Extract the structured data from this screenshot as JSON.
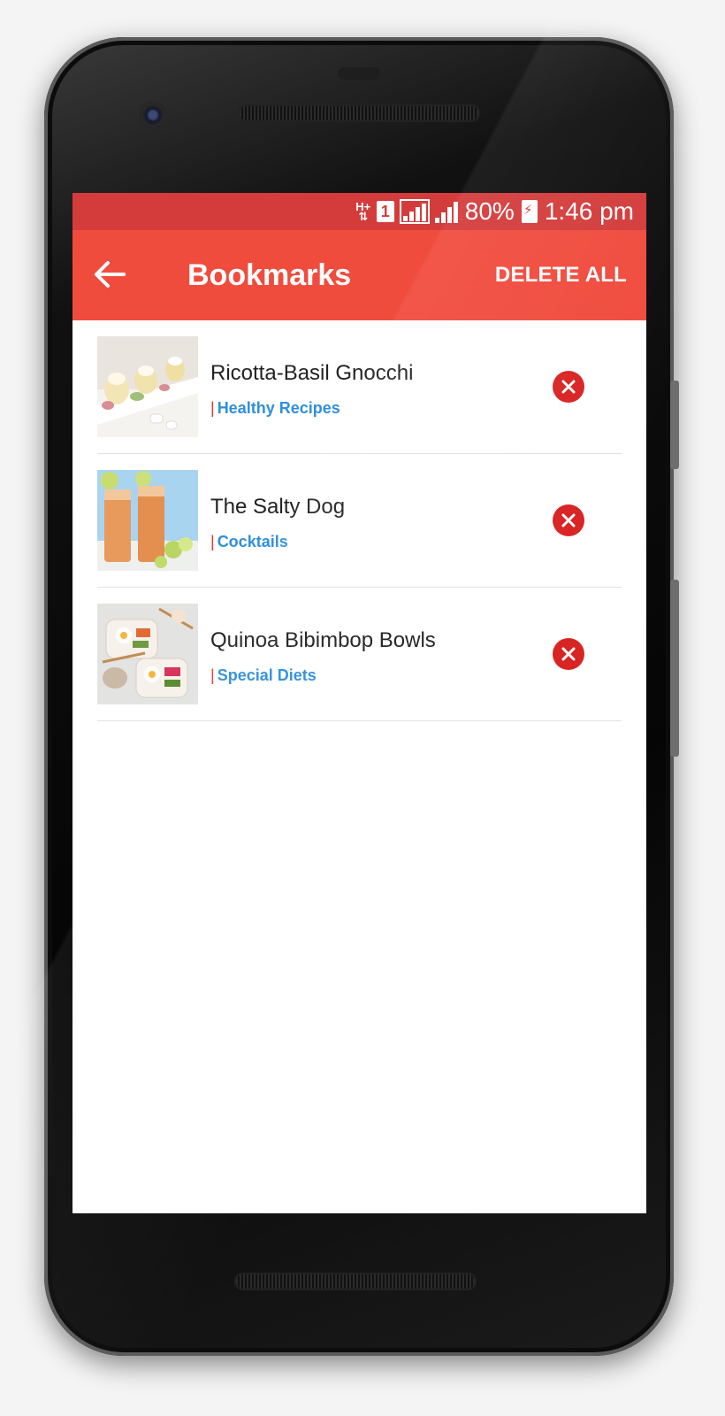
{
  "status_bar": {
    "network_type": "H+",
    "sim_slot": "1",
    "battery_percent": "80%",
    "time": "1:46 pm"
  },
  "app_bar": {
    "title": "Bookmarks",
    "delete_all_label": "DELETE ALL"
  },
  "bookmarks": [
    {
      "title": "Ricotta-Basil Gnocchi",
      "category": "Healthy Recipes",
      "thumbnail_icon": "gnocchi-dessert-photo"
    },
    {
      "title": "The Salty Dog",
      "category": "Cocktails",
      "thumbnail_icon": "cocktail-glasses-photo"
    },
    {
      "title": "Quinoa Bibimbop Bowls",
      "category": "Special Diets",
      "thumbnail_icon": "bibimbop-bowls-photo"
    }
  ],
  "category_separator": "|",
  "colors": {
    "status_bar": "#d43c3c",
    "app_bar": "#f04c3e",
    "category_text": "#2f8fdc",
    "remove_button": "#d92424"
  }
}
